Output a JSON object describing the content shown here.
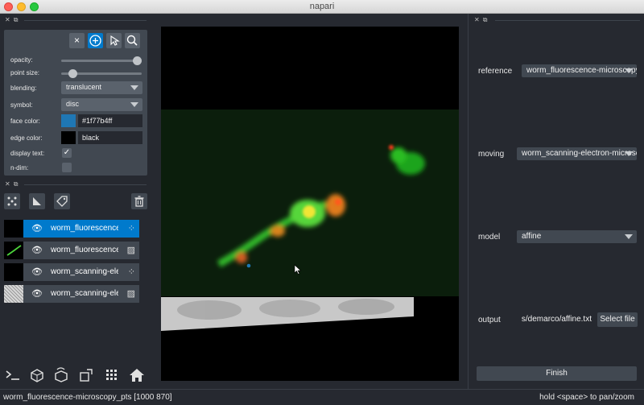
{
  "window": {
    "title": "napari"
  },
  "layer_controls": {
    "tools": {
      "delete": "×",
      "add": "+",
      "select": "arrow-cursor-icon",
      "zoom": "magnifier-icon"
    },
    "opacity_label": "opacity:",
    "opacity_value": 1.0,
    "point_size_label": "point size:",
    "blending_label": "blending:",
    "blending_value": "translucent",
    "symbol_label": "symbol:",
    "symbol_value": "disc",
    "face_color_label": "face color:",
    "face_color_value": "#1f77b4ff",
    "face_color_swatch": "#1f77b4",
    "edge_color_label": "edge color:",
    "edge_color_value": "black",
    "edge_color_swatch": "#000000",
    "display_text_label": "display text:",
    "display_text_checked": true,
    "ndim_label": "n-dim:",
    "ndim_checked": false
  },
  "layer_buttons": [
    "new-points-icon",
    "new-shapes-icon",
    "new-labels-icon",
    "delete-layer-icon"
  ],
  "layers": [
    {
      "name": "worm_fluorescence-microscopy_pts",
      "type": "points",
      "selected": true
    },
    {
      "name": "worm_fluorescence-microscopy",
      "type": "image",
      "selected": false
    },
    {
      "name": "worm_scanning-electron-microscopy_pts",
      "type": "points",
      "selected": false
    },
    {
      "name": "worm_scanning-electron-microscopy",
      "type": "image",
      "selected": false
    }
  ],
  "bottom_buttons": [
    "console-icon",
    "ndisplay-icon",
    "roll-dims-icon",
    "transpose-dims-icon",
    "grid-icon",
    "home-icon"
  ],
  "registration": {
    "reference_label": "reference",
    "reference_value": "worm_fluorescence-microscopy",
    "moving_label": "moving",
    "moving_value": "worm_scanning-electron-microscopy",
    "model_label": "model",
    "model_value": "affine",
    "output_label": "output",
    "output_value": "s/demarco/affine.txt",
    "select_file_label": "Select file",
    "finish_label": "Finish"
  },
  "status": {
    "left": "worm_fluorescence-microscopy_pts [1000  870]",
    "right": "hold <space> to pan/zoom"
  }
}
